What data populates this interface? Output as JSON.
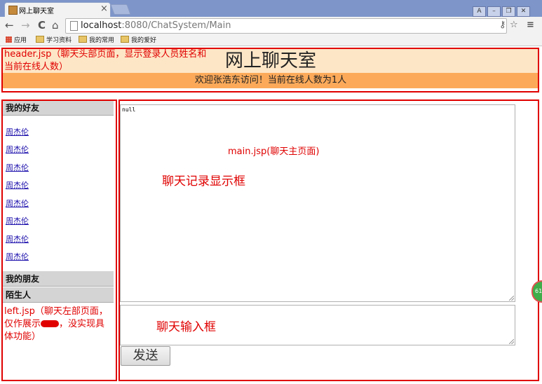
{
  "browser": {
    "tab_title": "网上聊天室",
    "tab_close": "×",
    "window_buttons": [
      "A",
      "–",
      "❐",
      "✕"
    ],
    "nav": {
      "back": "←",
      "forward": "→",
      "reload": "C",
      "home": "⌂"
    },
    "url_host": "localhost",
    "url_rest": ":8080/ChatSystem/Main",
    "toolbar_icons": {
      "key": "⚷",
      "star": "☆",
      "menu": "≡"
    },
    "bookmarks": [
      "应用",
      "学习资料",
      "我的常用",
      "我的爱好"
    ]
  },
  "header": {
    "title": "网上聊天室",
    "welcome": "欢迎张浩东访问！当前在线人数为1人",
    "annotation": "header.jsp（聊天头部页面，显示登录人员姓名和当前在线人数）"
  },
  "sidebar": {
    "sections": [
      {
        "label": "我的好友"
      },
      {
        "label": "我的朋友"
      },
      {
        "label": "陌生人"
      }
    ],
    "friends": [
      "周杰伦",
      "周杰伦",
      "周杰伦",
      "周杰伦",
      "周杰伦",
      "周杰伦",
      "周杰伦",
      "周杰伦"
    ],
    "annotation_before": "left.jsp（聊天左部页面，仅作展示",
    "annotation_after": "，没实现具体功能）"
  },
  "main": {
    "chatlog_text": "null",
    "send_label": "发送",
    "annotation_page": "main.jsp(聊天主页面)",
    "annotation_chatlog": "聊天记录显示框",
    "annotation_input": "聊天输入框"
  },
  "overlay": {
    "ball_text": "61"
  },
  "colors": {
    "annotation_red": "#e00000",
    "header_band": "#fde6c6",
    "welcome_band": "#fcaa5a",
    "section_gray": "#d4d4d4",
    "link": "#1a0dab"
  },
  "icons": [
    "page-favicon",
    "close-icon",
    "back-arrow-icon",
    "forward-arrow-icon",
    "reload-icon",
    "home-icon",
    "page-icon",
    "key-icon",
    "star-icon",
    "menu-icon",
    "apps-grid-icon",
    "folder-icon",
    "resize-grip-icon"
  ]
}
